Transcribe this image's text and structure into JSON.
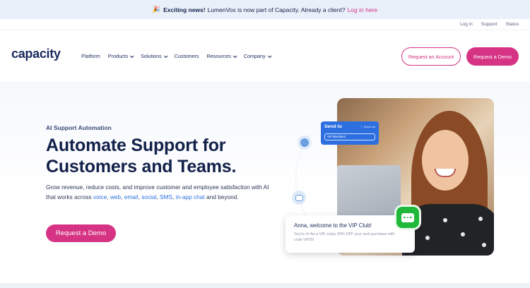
{
  "announcement": {
    "icon": "party-popper-icon",
    "bold": "Exciting news!",
    "text": "LumenVox is now part of Capacity. Already a client?",
    "link": "Log in here"
  },
  "utility_nav": [
    "Log in",
    "Support",
    "Status"
  ],
  "nav": {
    "logo": "capacity",
    "items": [
      {
        "label": "Platform",
        "dropdown": false
      },
      {
        "label": "Products",
        "dropdown": true
      },
      {
        "label": "Solutions",
        "dropdown": true
      },
      {
        "label": "Customers",
        "dropdown": false
      },
      {
        "label": "Resources",
        "dropdown": true
      },
      {
        "label": "Company",
        "dropdown": true
      }
    ],
    "request_account": "Request an Account",
    "request_demo": "Request a Demo"
  },
  "hero": {
    "eyebrow": "AI Support Automation",
    "headline_line1": "Automate Support for",
    "headline_line2": "Customers and Teams.",
    "desc_start": "Grow revenue, reduce costs, and improve customer and employee satisfaction with AI that works across",
    "links": [
      "voice",
      "web",
      "email",
      "social",
      "SMS",
      "in-app chat"
    ],
    "desc_end": "and beyond.",
    "cta": "Request a Demo"
  },
  "widgets": {
    "send_to_title": "Send to",
    "select_all": "✓ Select all",
    "segment": "VIP Members",
    "chat_title": "Anna, welcome to the VIP Club!",
    "chat_body": "You're in! As a VIP, enjoy 20% OFF your next purchase with code VIP20"
  },
  "colors": {
    "brand_pink": "#d63384",
    "navy": "#12214a",
    "link_blue": "#2f72e0",
    "chat_green": "#1fb83a"
  }
}
